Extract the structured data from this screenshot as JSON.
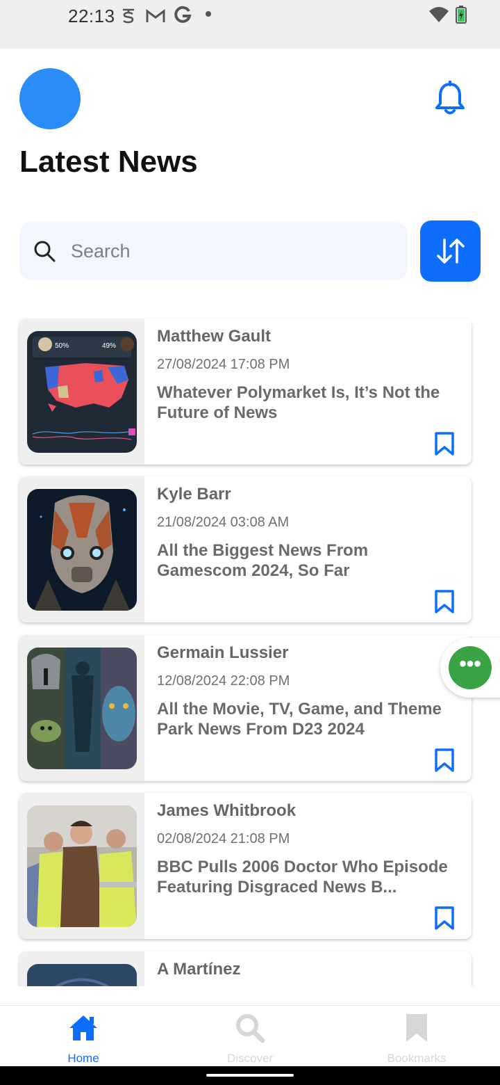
{
  "status_bar": {
    "time": "22:13",
    "icons": [
      "s-notification-icon",
      "gmail-icon",
      "google-icon",
      "dot-icon",
      "wifi-icon",
      "battery-charging-icon"
    ]
  },
  "header": {
    "title": "Latest News",
    "avatar_color": "#2a8cf7",
    "notification_icon": "bell-icon"
  },
  "search": {
    "placeholder": "Search",
    "value": ""
  },
  "sort_button": {
    "icon": "sort-arrows-icon",
    "color": "#0d6efd"
  },
  "articles": [
    {
      "author": "Matthew Gault",
      "date": "27/08/2024 17:08 PM",
      "title": "Whatever Polymarket Is, It’s Not the Future of News",
      "thumb_overlay": [
        "50%",
        "49%"
      ],
      "bookmark_icon": "bookmark-outline-icon"
    },
    {
      "author": "Kyle Barr",
      "date": "21/08/2024 03:08 AM",
      "title": "All the Biggest News From Gamescom 2024, So Far",
      "bookmark_icon": "bookmark-outline-icon"
    },
    {
      "author": "Germain Lussier",
      "date": "12/08/2024 22:08 PM",
      "title": "All the Movie, TV, Game, and Theme Park News From D23 2024",
      "bookmark_icon": "bookmark-outline-icon"
    },
    {
      "author": "James Whitbrook",
      "date": "02/08/2024 21:08 PM",
      "title": "BBC Pulls 2006 Doctor Who Episode Featuring Disgraced News B...",
      "bookmark_icon": "bookmark-outline-icon"
    },
    {
      "author": "A Martínez",
      "date": "",
      "title": "",
      "bookmark_icon": "bookmark-outline-icon"
    }
  ],
  "fab": {
    "icon": "more-dots-icon",
    "color": "#3aa346"
  },
  "bottom_nav": {
    "items": [
      {
        "label": "Home",
        "icon": "home-icon",
        "active": true,
        "color": "#0d6efd"
      },
      {
        "label": "Discover",
        "icon": "search-icon",
        "active": false,
        "color": "#d7d7d7"
      },
      {
        "label": "Bookmarks",
        "icon": "bookmark-filled-icon",
        "active": false,
        "color": "#d7d7d7"
      }
    ]
  }
}
